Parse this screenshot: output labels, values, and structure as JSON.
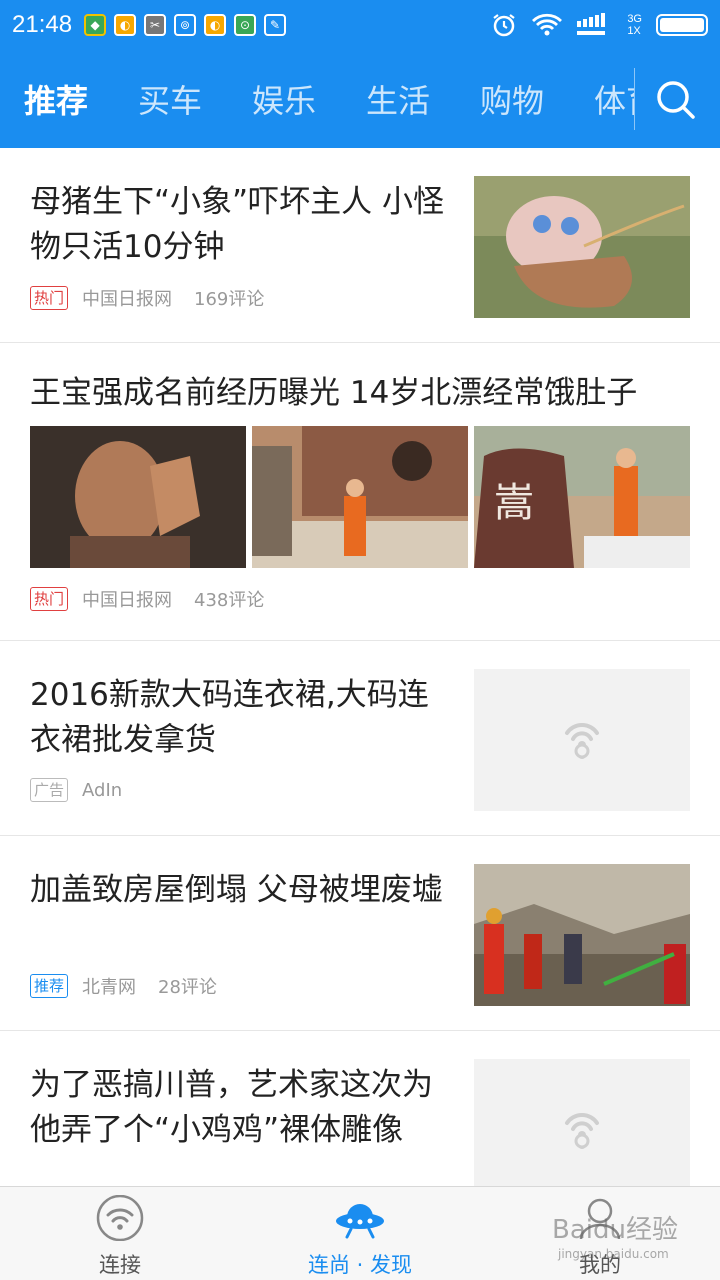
{
  "status": {
    "time": "21:48",
    "network_top": "3G",
    "network_bottom": "1X"
  },
  "nav": {
    "tabs": [
      {
        "label": "推荐",
        "active": true
      },
      {
        "label": "买车",
        "active": false
      },
      {
        "label": "娱乐",
        "active": false
      },
      {
        "label": "生活",
        "active": false
      },
      {
        "label": "购物",
        "active": false
      },
      {
        "label": "体育",
        "active": false
      }
    ]
  },
  "feed": {
    "items": [
      {
        "title": "母猪生下“小象”吓坏主人 小怪物只活10分钟",
        "tag": "热门",
        "source": "中国日报网",
        "comments": "169评论"
      },
      {
        "title": "王宝强成名前经历曝光 14岁北漂经常饿肚子",
        "tag": "热门",
        "source": "中国日报网",
        "comments": "438评论"
      },
      {
        "title": "2016新款大码连衣裙,大码连衣裙批发拿货",
        "tag": "广告",
        "source": "AdIn",
        "comments": ""
      },
      {
        "title": "加盖致房屋倒塌 父母被埋废墟",
        "tag": "推荐",
        "source": "北青网",
        "comments": "28评论"
      },
      {
        "title": "为了恶搞川普，艺术家这次为他弄了个“小鸡鸡”裸体雕像",
        "tag": "",
        "source": "",
        "comments": ""
      }
    ]
  },
  "bottom": {
    "items": [
      {
        "label": "连接",
        "icon": "wifi-icon"
      },
      {
        "label": "连尚 · 发现",
        "icon": "ufo-icon"
      },
      {
        "label": "我的",
        "icon": "profile-icon"
      }
    ]
  },
  "watermark": {
    "text1": "Baidu经验",
    "text2": "jingyan.baidu.com"
  },
  "colors": {
    "brand": "#1a8df0",
    "hot_tag": "#e04040"
  }
}
